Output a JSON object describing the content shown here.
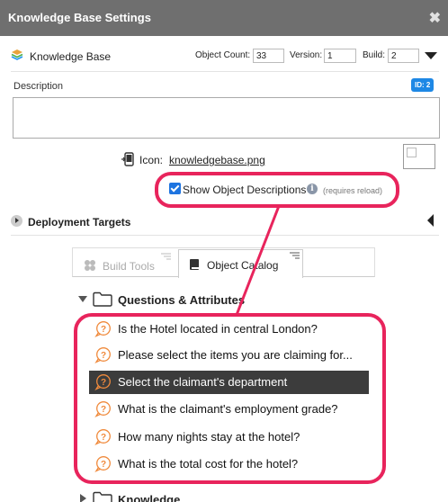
{
  "window": {
    "title": "Knowledge Base Settings",
    "close_glyph": "✖"
  },
  "kb": {
    "name": "Knowledge Base",
    "object_count_label": "Object Count:",
    "object_count": "33",
    "version_label": "Version:",
    "version": "1",
    "build_label": "Build:",
    "build": "2"
  },
  "description": {
    "label": "Description",
    "id_badge": "ID: 2",
    "value": ""
  },
  "icon": {
    "label": "Icon:",
    "file": "knowledgebase.png"
  },
  "show_descriptions": {
    "label": "Show Object Descriptions",
    "note": "(requires reload)",
    "checked": true,
    "info_glyph": "i"
  },
  "deployment": {
    "label": "Deployment Targets"
  },
  "tabs": [
    {
      "label": "Build Tools",
      "icon": "puzzle-icon",
      "active": false
    },
    {
      "label": "Object Catalog",
      "icon": "book-icon",
      "active": true
    }
  ],
  "tree": {
    "folder_open": {
      "label": "Questions & Attributes"
    },
    "questions": [
      {
        "label": "Is the Hotel located in central London?",
        "selected": false
      },
      {
        "label": "Please select the items you are claiming for...",
        "selected": false
      },
      {
        "label": "Select the claimant's department",
        "selected": true
      },
      {
        "label": "What is the claimant's employment grade?",
        "selected": false
      },
      {
        "label": "How many nights stay at the hotel?",
        "selected": false
      },
      {
        "label": "What is the total cost for the hotel?",
        "selected": false
      }
    ],
    "folder_closed": {
      "label": "Knowledge"
    }
  },
  "colors": {
    "titlebar": "#6f6f6f",
    "accent_blue": "#1e88e5",
    "highlight": "#e8245c",
    "question_icon": "#f08a3c",
    "selected_row": "#3c3c3c"
  }
}
